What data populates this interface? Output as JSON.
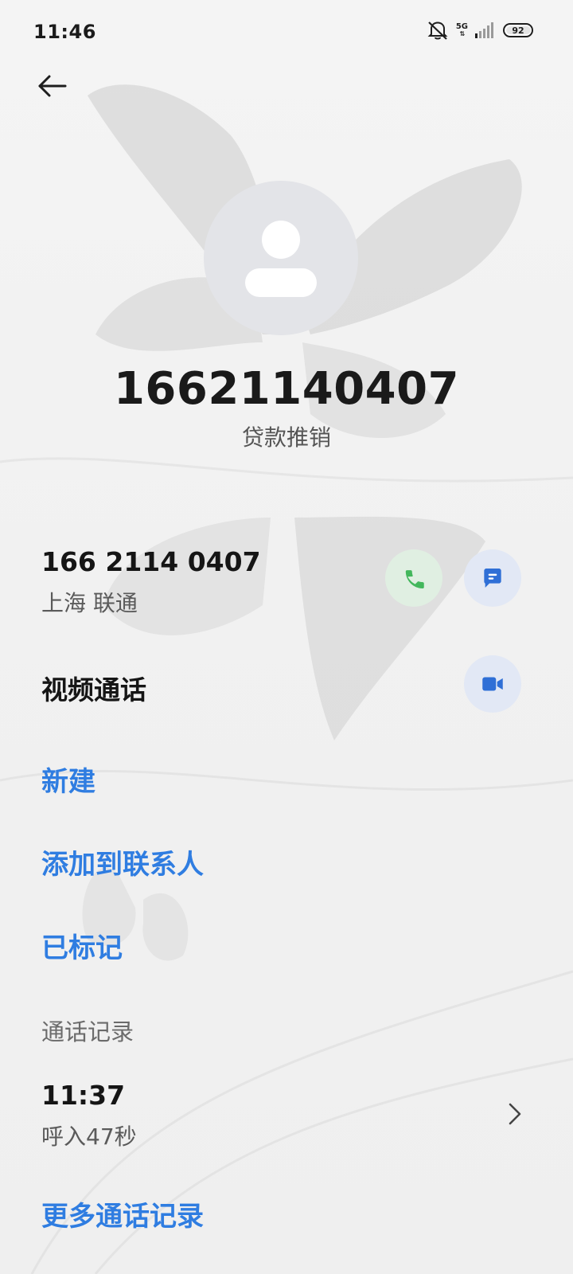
{
  "status_bar": {
    "time": "11:46",
    "network": "5G",
    "battery_level": "92",
    "icons": [
      "mute-bell-icon",
      "network-5g-icon",
      "signal-bars-icon",
      "battery-icon"
    ]
  },
  "header": {
    "back_icon": "arrow-left-icon",
    "avatar_icon": "person-avatar-icon"
  },
  "contact": {
    "name": "16621140407",
    "tag": "贷款推销"
  },
  "number_row": {
    "formatted_number": "166 2114 0407",
    "location": "上海 联通",
    "call_icon": "phone-icon",
    "message_icon": "message-icon"
  },
  "video_row": {
    "label": "视频通话",
    "icon": "video-camera-icon"
  },
  "actions": {
    "new": "新建",
    "add_to_contacts": "添加到联系人",
    "marked": "已标记"
  },
  "call_log": {
    "section_title": "通话记录",
    "entries": [
      {
        "time": "11:37",
        "detail": "呼入47秒"
      }
    ],
    "more": "更多通话记录"
  },
  "colors": {
    "accent_blue": "#2f7de1",
    "call_green": "#43b75c",
    "icon_blue": "#2f6fd6",
    "avatar_bg": "#e3e4e8"
  }
}
